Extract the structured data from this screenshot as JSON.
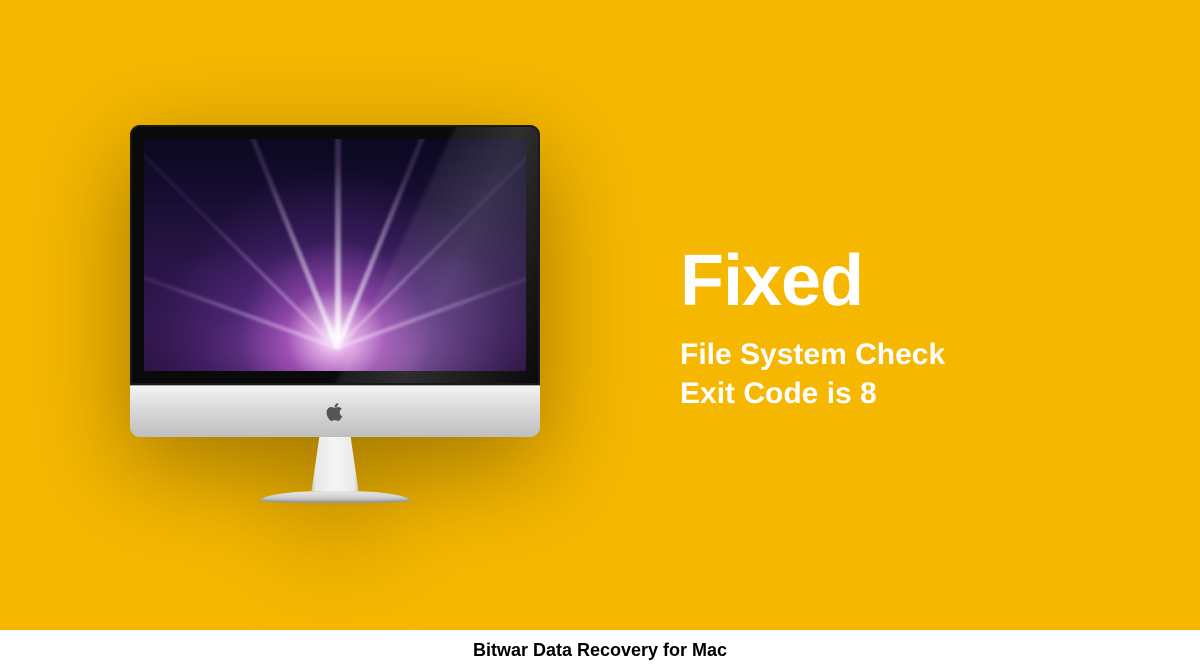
{
  "hero": {
    "headline": "Fixed",
    "subline_1": "File System Check",
    "subline_2": "Exit Code is 8"
  },
  "footer": {
    "caption": "Bitwar Data Recovery for Mac"
  },
  "icons": {
    "apple_logo": "apple-logo-icon"
  },
  "colors": {
    "background": "#F5B700",
    "text": "#FFFFFF",
    "footer_bg": "#FFFFFF",
    "footer_text": "#000000"
  }
}
